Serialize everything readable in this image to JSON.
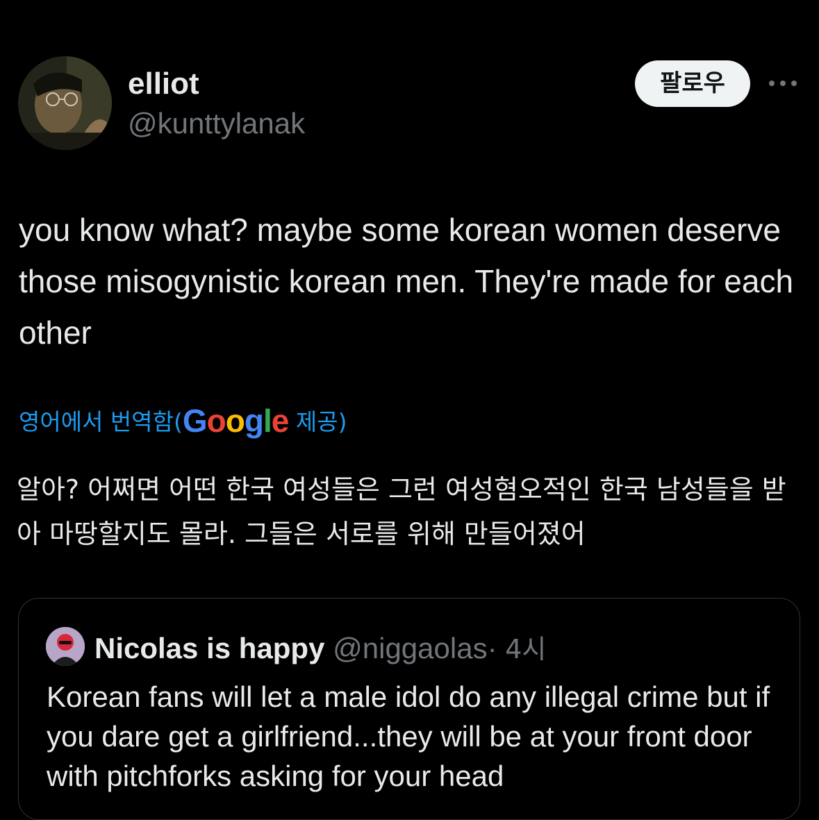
{
  "tweet": {
    "author": {
      "display_name": "elliot",
      "handle": "@kunttylanak"
    },
    "follow_button_label": "팔로우",
    "more_icon": "more-horizontal-icon",
    "text": "you know what? maybe some korean women deserve those misogynistic korean men. They're made for each other",
    "translation": {
      "prefix": "영어에서 번역함(",
      "google_logo": "Google",
      "suffix": " 제공)",
      "text": "알아? 어쩌면 어떤 한국 여성들은 그런 여성혐오적인 한국 남성들을 받아 마땅할지도 몰라. 그들은 서로를 위해 만들어졌어"
    }
  },
  "quoted_tweet": {
    "display_name": "Nicolas is happy",
    "handle": "@niggaolas",
    "separator": "·",
    "time": "4시",
    "text": "Korean fans will let a male idol do any illegal crime but if you dare get a girlfriend...they will be at your front door with pitchforks asking for your head"
  },
  "colors": {
    "background": "#000000",
    "primary_text": "#e7e9ea",
    "secondary_text": "#71767b",
    "link": "#1d9bf0",
    "border": "#2f3336"
  }
}
